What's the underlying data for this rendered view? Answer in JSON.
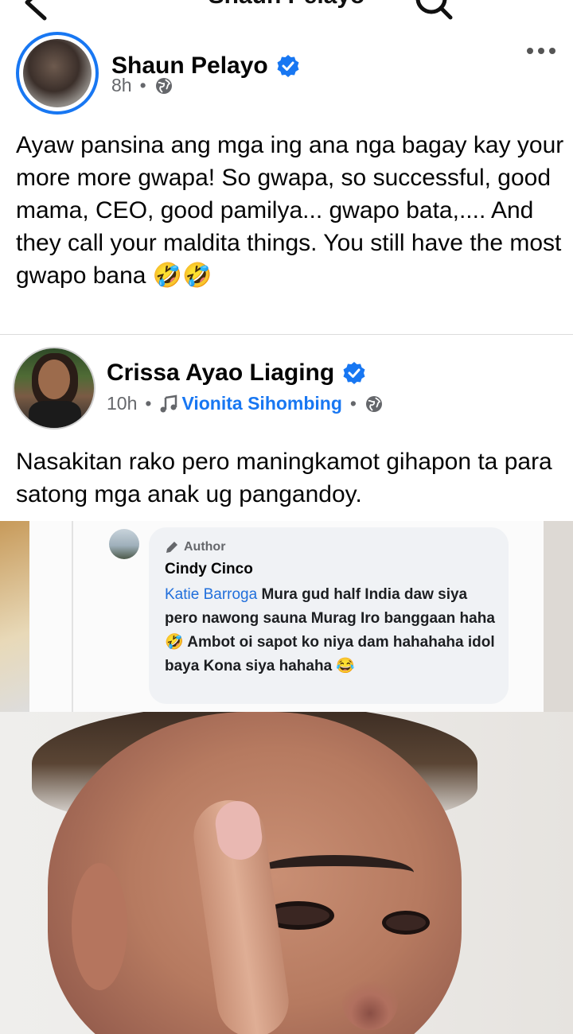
{
  "header": {
    "title": "Shaun Pelayo",
    "back_icon": "back-arrow-icon",
    "search_icon": "search-icon"
  },
  "post1": {
    "author": "Shaun Pelayo",
    "verified_icon": "verified-badge-icon",
    "time": "8h",
    "separator": "•",
    "audience_icon": "globe-icon",
    "more_icon": "more-options-icon",
    "text": "Ayaw pansina ang mga ing ana nga bagay kay your more more gwapa! So gwapa, so successful, good mama, CEO, good pamilya... gwapo bata,.... And they call your maldita things. You still have the most gwapo bana 🤣🤣"
  },
  "post2": {
    "author": "Crissa Ayao Liaging",
    "verified_icon": "verified-badge-icon",
    "time": "10h",
    "separator": "•",
    "music_icon": "music-note-icon",
    "song": "Vionita Sihombing",
    "separator2": "•",
    "audience_icon": "globe-icon",
    "text": "Nasakitan rako pero maningkamot gihapon ta para satong mga anak ug pangandoy.",
    "image": {
      "comment": {
        "badge": "Author",
        "badge_icon": "pencil-icon",
        "name": "Cindy Cinco",
        "mention": "Katie Barroga",
        "text_part1": " Mura gud half India daw siya pero nawong sauna Murag Iro banggaan haha 🤣 Ambot oi sapot ko niya dam hahahaha idol baya Kona siya hahaha 😂"
      }
    }
  },
  "colors": {
    "brand_blue": "#1877f2",
    "meta_gray": "#65676b"
  }
}
